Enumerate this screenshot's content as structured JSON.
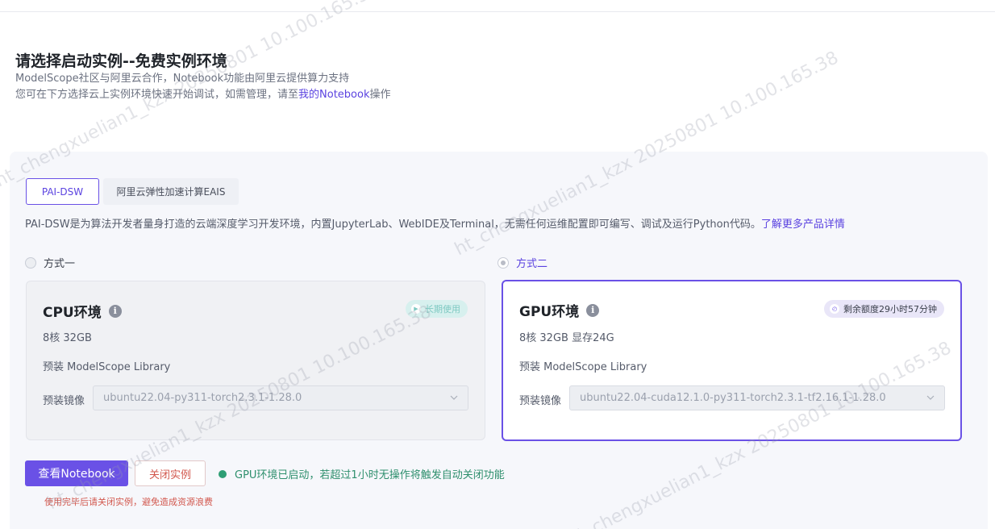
{
  "header": {
    "title": "请选择启动实例--免费实例环境",
    "subtitle_line1": "ModelScope社区与阿里云合作，Notebook功能由阿里云提供算力支持",
    "subtitle_line2_pre": "您可在下方选择云上实例环境快速开始调试，如需管理，请至",
    "subtitle_line2_link": "我的Notebook",
    "subtitle_line2_post": "操作"
  },
  "tabs": [
    {
      "label": "PAI-DSW",
      "active": true
    },
    {
      "label": "阿里云弹性加速计算EAIS",
      "active": false
    }
  ],
  "description": {
    "text": "PAI-DSW是为算法开发者量身打造的云端深度学习开发环境，内置JupyterLab、WebIDE及Terminal，无需任何运维配置即可编写、调试及运行Python代码。",
    "link": "了解更多产品详情"
  },
  "options": [
    {
      "label": "方式一",
      "checked": false
    },
    {
      "label": "方式二",
      "checked": true
    }
  ],
  "cpu_card": {
    "title": "CPU环境",
    "badge": "长期使用",
    "spec": "8核 32GB",
    "preinstall": "预装 ModelScope Library",
    "image_label": "预装镜像",
    "image_value": "ubuntu22.04-py311-torch2.3.1-1.28.0"
  },
  "gpu_card": {
    "title": "GPU环境",
    "badge": "剩余额度29小时57分钟",
    "spec": "8核 32GB 显存24G",
    "preinstall": "预装 ModelScope Library",
    "image_label": "预装镜像",
    "image_value": "ubuntu22.04-cuda12.1.0-py311-torch2.3.1-tf2.16.1-1.28.0"
  },
  "actions": {
    "view_notebook": "查看Notebook",
    "close_instance": "关闭实例",
    "status": "GPU环境已启动，若超过1小时无操作将触发自动关闭功能",
    "warning": "使用完毕后请关闭实例，避免造成资源浪费"
  },
  "watermarks": [
    "ht_chengxuelian1_kzx 20250801 10.100.165.38",
    "ht_chengxuelian1_kzx 20250801 10.100.165.38",
    "ht_chengxuelian1_kzx 20250801 10.100.165.38",
    "ht_chengxuelian1_kzx 20250801 10.100.165.38"
  ],
  "colors": {
    "accent": "#6a51e6",
    "danger": "#d2574d",
    "success": "#2e9e74"
  }
}
